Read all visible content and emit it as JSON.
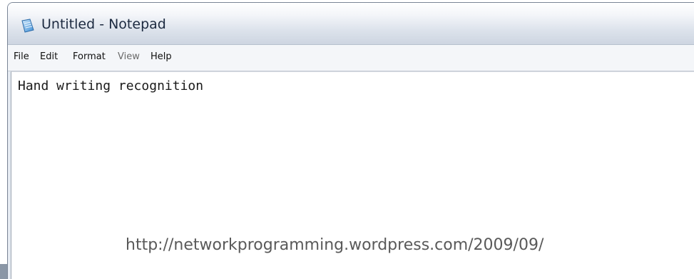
{
  "window": {
    "title": "Untitled - Notepad",
    "icon": "notepad-icon"
  },
  "menu": {
    "items": [
      {
        "label": "File"
      },
      {
        "label": "Edit"
      },
      {
        "label": "Format"
      },
      {
        "label": "View"
      },
      {
        "label": "Help"
      }
    ]
  },
  "document": {
    "content": "Hand writing recognition"
  },
  "caption": {
    "url": "http://networkprogramming.wordpress.com/2009/09/"
  },
  "colors": {
    "title_bar_top": "#ffffff",
    "title_bar_bottom": "#cdd5e1",
    "caption_text": "#595959"
  }
}
